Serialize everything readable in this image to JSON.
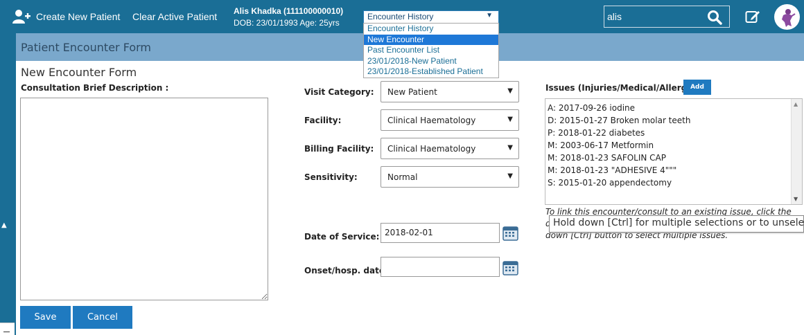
{
  "topbar": {
    "create_new_patient": "Create New Patient",
    "clear_active_patient": "Clear Active Patient",
    "patient_name": "Alis Khadka (111100000010)",
    "patient_dob": "DOB: 23/01/1993 Age: 25yrs",
    "encounter_select": "Encounter History",
    "encounter_options": [
      "Encounter History",
      "New Encounter",
      "Past Encounter List",
      "23/01/2018-New Patient",
      "23/01/2018-Established Patient"
    ],
    "search_value": "alis"
  },
  "form": {
    "header_title": "Patient Encounter Form",
    "sub_title": "New Encounter Form",
    "desc_label": "Consultation Brief Description :",
    "visit_category_label": "Visit Category:",
    "visit_category_value": "New Patient",
    "facility_label": "Facility:",
    "facility_value": "Clinical Haematology",
    "billing_facility_label": "Billing Facility:",
    "billing_facility_value": "Clinical Haematology",
    "sensitivity_label": "Sensitivity:",
    "sensitivity_value": "Normal",
    "date_of_service_label": "Date of Service:",
    "date_of_service_value": "2018-02-01",
    "onset_label": "Onset/hosp. date:",
    "onset_value": "",
    "save": "Save",
    "cancel": "Cancel"
  },
  "issues": {
    "label": "Issues (Injuries/Medical/Allergy)",
    "add": "Add",
    "items": [
      "A: 2017-09-26 iodine",
      "D: 2015-01-27 Broken molar teeth",
      "P: 2018-01-22 diabetes",
      "M: 2003-06-17 Metformin",
      "M: 2018-01-23 SAFOLIN CAP",
      "M: 2018-01-23 \"ADHESIVE 4\"\"\"",
      "S: 2015-01-20 appendectomy"
    ],
    "help_line1": "To link this encounter/consult to an existing issue, click the",
    "help_line2": "d",
    "help_line3": "down [Ctrl] button to select multiple issues.",
    "tooltip": "Hold down [Ctrl] for multiple selections or to unselect"
  },
  "colors": {
    "topbar": "#1a6e96",
    "form_header": "#7aa8cc",
    "button": "#1f7ac0",
    "dropdown_selected": "#1e78d7"
  }
}
